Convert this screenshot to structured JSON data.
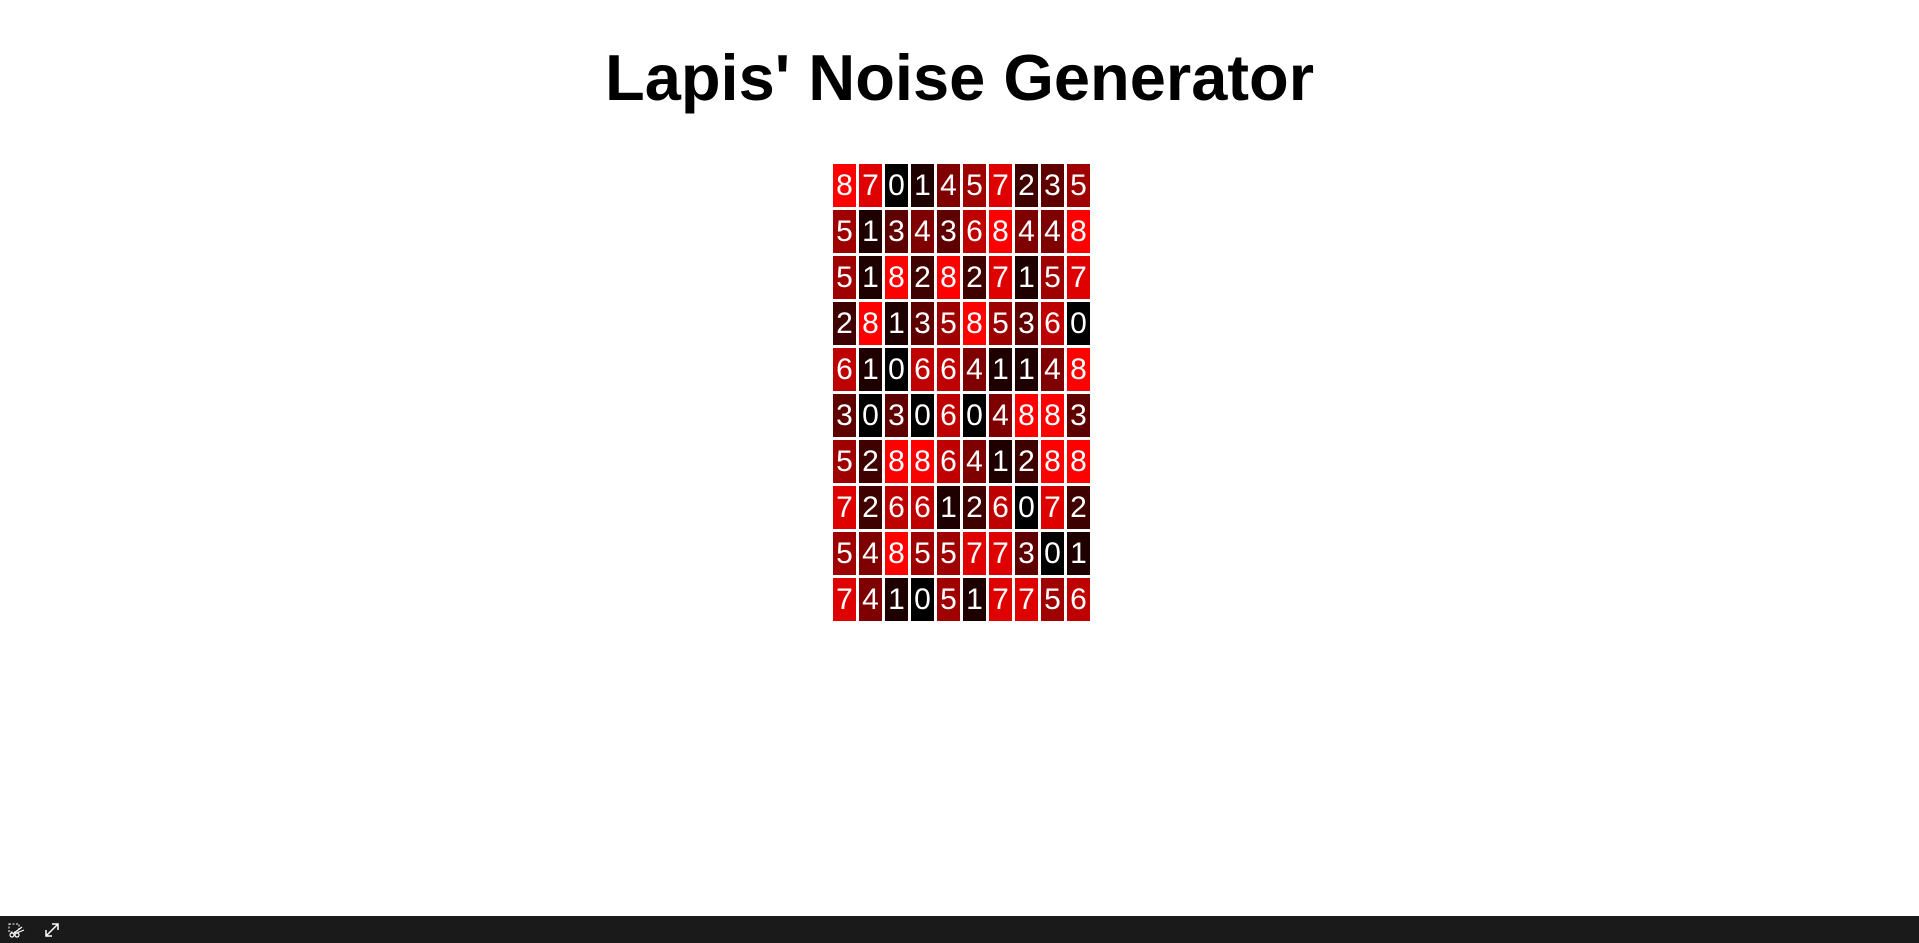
{
  "title": "Lapis' Noise Generator",
  "palette": {
    "0": "#000000",
    "1": "#1f0000",
    "2": "#3f0000",
    "3": "#5f0000",
    "4": "#7f0000",
    "5": "#9f0000",
    "6": "#bf0000",
    "7": "#df0000",
    "8": "#ff0000"
  },
  "grid": [
    [
      "8",
      "7",
      "0",
      "1",
      "4",
      "5",
      "7",
      "2",
      "3",
      "5"
    ],
    [
      "5",
      "1",
      "3",
      "4",
      "3",
      "6",
      "8",
      "4",
      "4",
      "8"
    ],
    [
      "5",
      "1",
      "8",
      "2",
      "8",
      "2",
      "7",
      "1",
      "5",
      "7"
    ],
    [
      "2",
      "8",
      "1",
      "3",
      "5",
      "8",
      "5",
      "3",
      "6",
      "0"
    ],
    [
      "6",
      "1",
      "0",
      "6",
      "6",
      "4",
      "1",
      "1",
      "4",
      "8"
    ],
    [
      "3",
      "0",
      "3",
      "0",
      "6",
      "0",
      "4",
      "8",
      "8",
      "3"
    ],
    [
      "5",
      "2",
      "8",
      "8",
      "6",
      "4",
      "1",
      "2",
      "8",
      "8"
    ],
    [
      "7",
      "2",
      "6",
      "6",
      "1",
      "2",
      "6",
      "0",
      "7",
      "2"
    ],
    [
      "5",
      "4",
      "8",
      "5",
      "5",
      "7",
      "7",
      "3",
      "0",
      "1"
    ],
    [
      "7",
      "4",
      "1",
      "0",
      "5",
      "1",
      "7",
      "7",
      "5",
      "6"
    ]
  ],
  "toolbar": {
    "left_icon": "scissors-select-icon",
    "right_icon": "expand-icon"
  }
}
